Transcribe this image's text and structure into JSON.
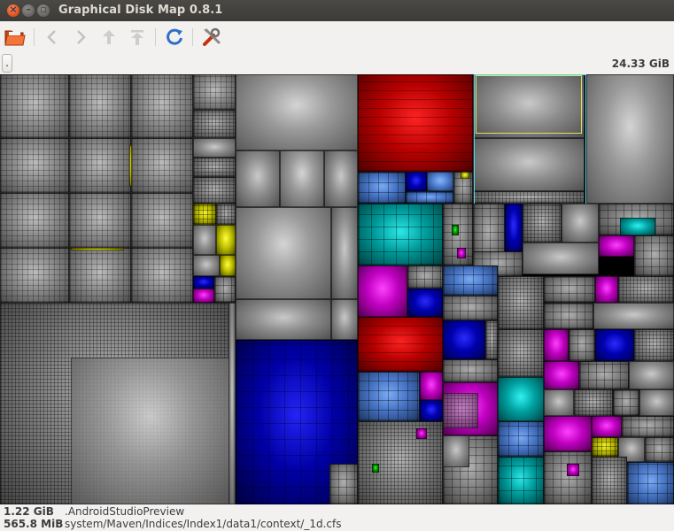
{
  "window": {
    "title": "Graphical Disk Map 0.8.1",
    "close_glyph": "×",
    "minimize_glyph": "–",
    "maximize_glyph": "▫"
  },
  "toolbar": {
    "buttons": [
      {
        "id": "open",
        "icon": "folder-open-icon"
      },
      {
        "id": "back",
        "icon": "chevron-left-icon",
        "enabled": false
      },
      {
        "id": "forward",
        "icon": "chevron-right-icon",
        "enabled": false
      },
      {
        "id": "up",
        "icon": "arrow-up-icon",
        "enabled": false
      },
      {
        "id": "top",
        "icon": "arrow-top-icon",
        "enabled": false
      },
      {
        "id": "refresh",
        "icon": "refresh-icon",
        "enabled": true
      },
      {
        "id": "settings",
        "icon": "tools-icon",
        "enabled": true
      }
    ]
  },
  "path_bar": {
    "root_label": ".",
    "total_size": "24.33 GiB"
  },
  "colors": {
    "accent_selection_outer": "#52d8e6",
    "accent_selection_inner": "#e4e060"
  },
  "status": {
    "line1_size": "1.22 GiB",
    "line1_name": ".AndroidStudioPreview",
    "line2_size": "565.8 MiB",
    "line2_name": "system/Maven/Indices/Index1/data1/context/_1d.cfs"
  }
}
